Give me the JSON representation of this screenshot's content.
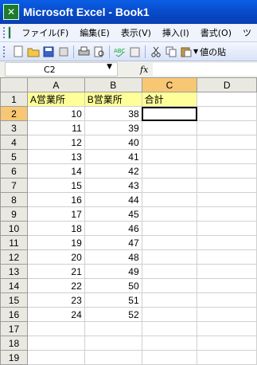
{
  "window": {
    "title": "Microsoft Excel - Book1",
    "app_icon": "excel-icon"
  },
  "menu": [
    "ファイル(F)",
    "編集(E)",
    "表示(V)",
    "挿入(I)",
    "書式(O)",
    "ツ"
  ],
  "toolbar": {
    "paste_value_label": "値の貼",
    "icons": [
      "new-icon",
      "open-icon",
      "save-icon",
      "permission-icon",
      "print-icon",
      "print-preview-icon",
      "spelling-icon",
      "research-icon",
      "cut-icon",
      "copy-icon",
      "paste-icon"
    ]
  },
  "formula_bar": {
    "name_box": "C2",
    "fx": "fx",
    "formula": ""
  },
  "columns": [
    "A",
    "B",
    "C",
    "D"
  ],
  "selected_column": "C",
  "selected_row": "2",
  "rows": [
    {
      "n": "1",
      "a": "A営業所",
      "b": "B営業所",
      "c": "合計"
    },
    {
      "n": "2",
      "a": "10",
      "b": "38",
      "c": ""
    },
    {
      "n": "3",
      "a": "11",
      "b": "39",
      "c": ""
    },
    {
      "n": "4",
      "a": "12",
      "b": "40",
      "c": ""
    },
    {
      "n": "5",
      "a": "13",
      "b": "41",
      "c": ""
    },
    {
      "n": "6",
      "a": "14",
      "b": "42",
      "c": ""
    },
    {
      "n": "7",
      "a": "15",
      "b": "43",
      "c": ""
    },
    {
      "n": "8",
      "a": "16",
      "b": "44",
      "c": ""
    },
    {
      "n": "9",
      "a": "17",
      "b": "45",
      "c": ""
    },
    {
      "n": "10",
      "a": "18",
      "b": "46",
      "c": ""
    },
    {
      "n": "11",
      "a": "19",
      "b": "47",
      "c": ""
    },
    {
      "n": "12",
      "a": "20",
      "b": "48",
      "c": ""
    },
    {
      "n": "13",
      "a": "21",
      "b": "49",
      "c": ""
    },
    {
      "n": "14",
      "a": "22",
      "b": "50",
      "c": ""
    },
    {
      "n": "15",
      "a": "23",
      "b": "51",
      "c": ""
    },
    {
      "n": "16",
      "a": "24",
      "b": "52",
      "c": ""
    },
    {
      "n": "17",
      "a": "",
      "b": "",
      "c": ""
    },
    {
      "n": "18",
      "a": "",
      "b": "",
      "c": ""
    },
    {
      "n": "19",
      "a": "",
      "b": "",
      "c": ""
    }
  ]
}
